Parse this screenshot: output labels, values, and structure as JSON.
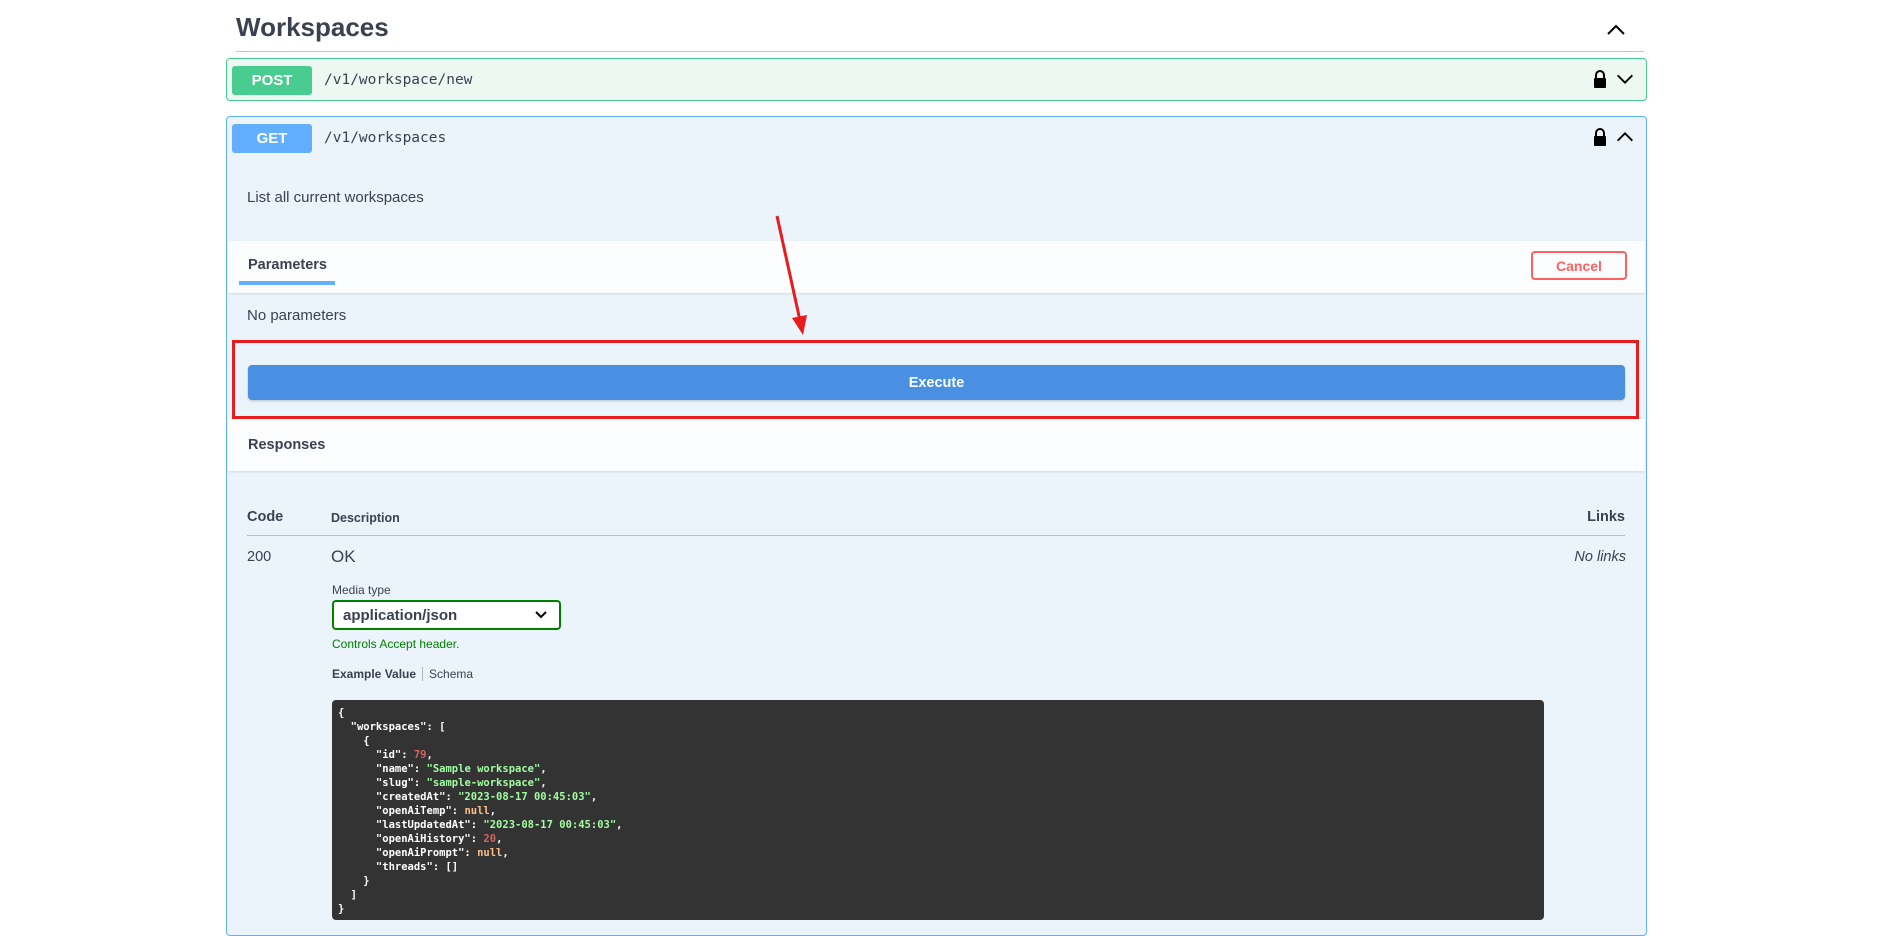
{
  "section": {
    "title": "Workspaces"
  },
  "post_op": {
    "method": "POST",
    "path": "/v1/workspace/new"
  },
  "get_op": {
    "method": "GET",
    "path": "/v1/workspaces",
    "description": "List all current workspaces",
    "parameters_title": "Parameters",
    "cancel_label": "Cancel",
    "no_parameters": "No parameters",
    "execute_label": "Execute",
    "responses_title": "Responses"
  },
  "responses": {
    "headers": {
      "code": "Code",
      "description": "Description",
      "links": "Links"
    },
    "rows": [
      {
        "code": "200",
        "description": "OK",
        "links": "No links",
        "media_type_label": "Media type",
        "media_type_value": "application/json",
        "controls_text": "Controls Accept header.",
        "tab_example": "Example Value",
        "tab_schema": "Schema"
      }
    ]
  },
  "example_json": {
    "lines": [
      [
        {
          "t": "p",
          "v": "{"
        }
      ],
      [
        {
          "t": "p",
          "v": "  \"workspaces\": ["
        }
      ],
      [
        {
          "t": "p",
          "v": "    {"
        }
      ],
      [
        {
          "t": "p",
          "v": "      \"id\": "
        },
        {
          "t": "num",
          "v": "79"
        },
        {
          "t": "p",
          "v": ","
        }
      ],
      [
        {
          "t": "p",
          "v": "      \"name\": "
        },
        {
          "t": "str",
          "v": "\"Sample workspace\""
        },
        {
          "t": "p",
          "v": ","
        }
      ],
      [
        {
          "t": "p",
          "v": "      \"slug\": "
        },
        {
          "t": "str",
          "v": "\"sample-workspace\""
        },
        {
          "t": "p",
          "v": ","
        }
      ],
      [
        {
          "t": "p",
          "v": "      \"createdAt\": "
        },
        {
          "t": "str",
          "v": "\"2023-08-17 00:45:03\""
        },
        {
          "t": "p",
          "v": ","
        }
      ],
      [
        {
          "t": "p",
          "v": "      \"openAiTemp\": "
        },
        {
          "t": "lit",
          "v": "null"
        },
        {
          "t": "p",
          "v": ","
        }
      ],
      [
        {
          "t": "p",
          "v": "      \"lastUpdatedAt\": "
        },
        {
          "t": "str",
          "v": "\"2023-08-17 00:45:03\""
        },
        {
          "t": "p",
          "v": ","
        }
      ],
      [
        {
          "t": "p",
          "v": "      \"openAiHistory\": "
        },
        {
          "t": "num",
          "v": "20"
        },
        {
          "t": "p",
          "v": ","
        }
      ],
      [
        {
          "t": "p",
          "v": "      \"openAiPrompt\": "
        },
        {
          "t": "lit",
          "v": "null"
        },
        {
          "t": "p",
          "v": ","
        }
      ],
      [
        {
          "t": "p",
          "v": "      \"threads\": []"
        }
      ],
      [
        {
          "t": "p",
          "v": "    }"
        }
      ],
      [
        {
          "t": "p",
          "v": "  ]"
        }
      ],
      [
        {
          "t": "p",
          "v": "}"
        }
      ]
    ]
  },
  "icons": {
    "section_toggle": "chevron-up-icon",
    "post_lock": "lock-icon",
    "post_toggle": "chevron-down-icon",
    "get_lock": "lock-icon",
    "get_toggle": "chevron-up-icon",
    "select_arrow": "chevron-down-icon"
  },
  "colors": {
    "post": "#49cc90",
    "get": "#61affe",
    "execute": "#4990e2",
    "cancel": "#ff6060",
    "annotation": "#e81c1c"
  }
}
